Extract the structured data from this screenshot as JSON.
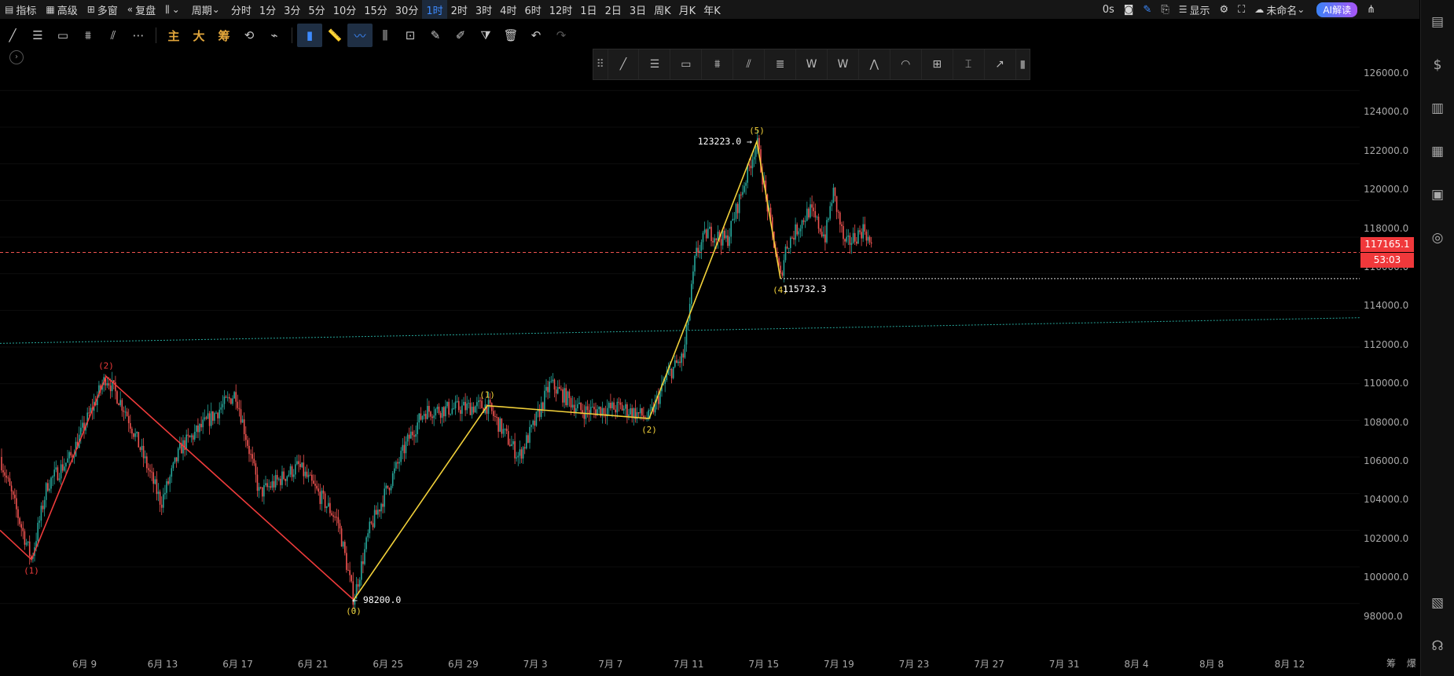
{
  "topbar": {
    "indicator": "指标",
    "advanced": "高级",
    "multi_window": "多窗",
    "replay": "复盘",
    "period_label": "周期",
    "periods": [
      "分时",
      "1分",
      "3分",
      "5分",
      "10分",
      "15分",
      "30分",
      "1时",
      "2时",
      "3时",
      "4时",
      "6时",
      "12时",
      "1日",
      "2日",
      "3日",
      "周K",
      "月K",
      "年K"
    ],
    "active_period": "1时",
    "latency": "0s",
    "display": "显示",
    "unnamed": "未命名",
    "ai": "AI解读"
  },
  "toolbar2": {
    "main": "主",
    "big": "大",
    "chip": "筹"
  },
  "colors": {
    "up": "#26a69a",
    "down": "#ef5350",
    "wave_red": "#ef3b3b",
    "wave_yellow": "#f2d13a",
    "price_tag": "#f0383b",
    "accent": "#3d8bff"
  },
  "price_axis": {
    "labels": [
      "126000.0",
      "124000.0",
      "122000.0",
      "120000.0",
      "118000.0",
      "116000.0",
      "114000.0",
      "112000.0",
      "110000.0",
      "108000.0",
      "106000.0",
      "104000.0",
      "102000.0",
      "100000.0",
      "98000.0"
    ],
    "current_price": "117165.1",
    "countdown": "53:03"
  },
  "date_axis": [
    "6月 9",
    "6月 13",
    "6月 17",
    "6月 21",
    "6月 25",
    "6月 29",
    "7月 3",
    "7月 7",
    "7月 11",
    "7月 15",
    "7月 19",
    "7月 23",
    "7月 27",
    "7月 31",
    "8月 4",
    "8月 8",
    "8月 12"
  ],
  "bottom_right": {
    "a": "筹",
    "b": "爆"
  },
  "chart_data": {
    "type": "candlestick",
    "ylim": [
      97000,
      127000
    ],
    "current_price": 117165.1,
    "red_wave": {
      "points": [
        [
          0,
          102000
        ],
        [
          40,
          100400
        ],
        [
          135,
          110400
        ],
        [
          450,
          98200
        ]
      ],
      "labels": [
        {
          "text": "(1)",
          "point": 1
        },
        {
          "text": "(2)",
          "point": 2
        }
      ]
    },
    "yellow_wave": {
      "points": [
        [
          450,
          98200
        ],
        [
          620,
          108800
        ],
        [
          826,
          108100
        ],
        [
          963,
          123223
        ],
        [
          993,
          115732.3
        ]
      ],
      "labels": [
        {
          "text": "(0)",
          "point": 0
        },
        {
          "text": "(1)",
          "point": 1
        },
        {
          "text": "(2)",
          "point": 2
        },
        {
          "text": "(5)",
          "point": 3
        },
        {
          "text": "(4)",
          "point": 4
        }
      ]
    },
    "annotations": {
      "high": "123223.0 →",
      "low": "← 98200.0",
      "wave4": "115732.3"
    },
    "trendline": {
      "from": 112200,
      "to": 113600
    },
    "support_level": 115732.3
  }
}
